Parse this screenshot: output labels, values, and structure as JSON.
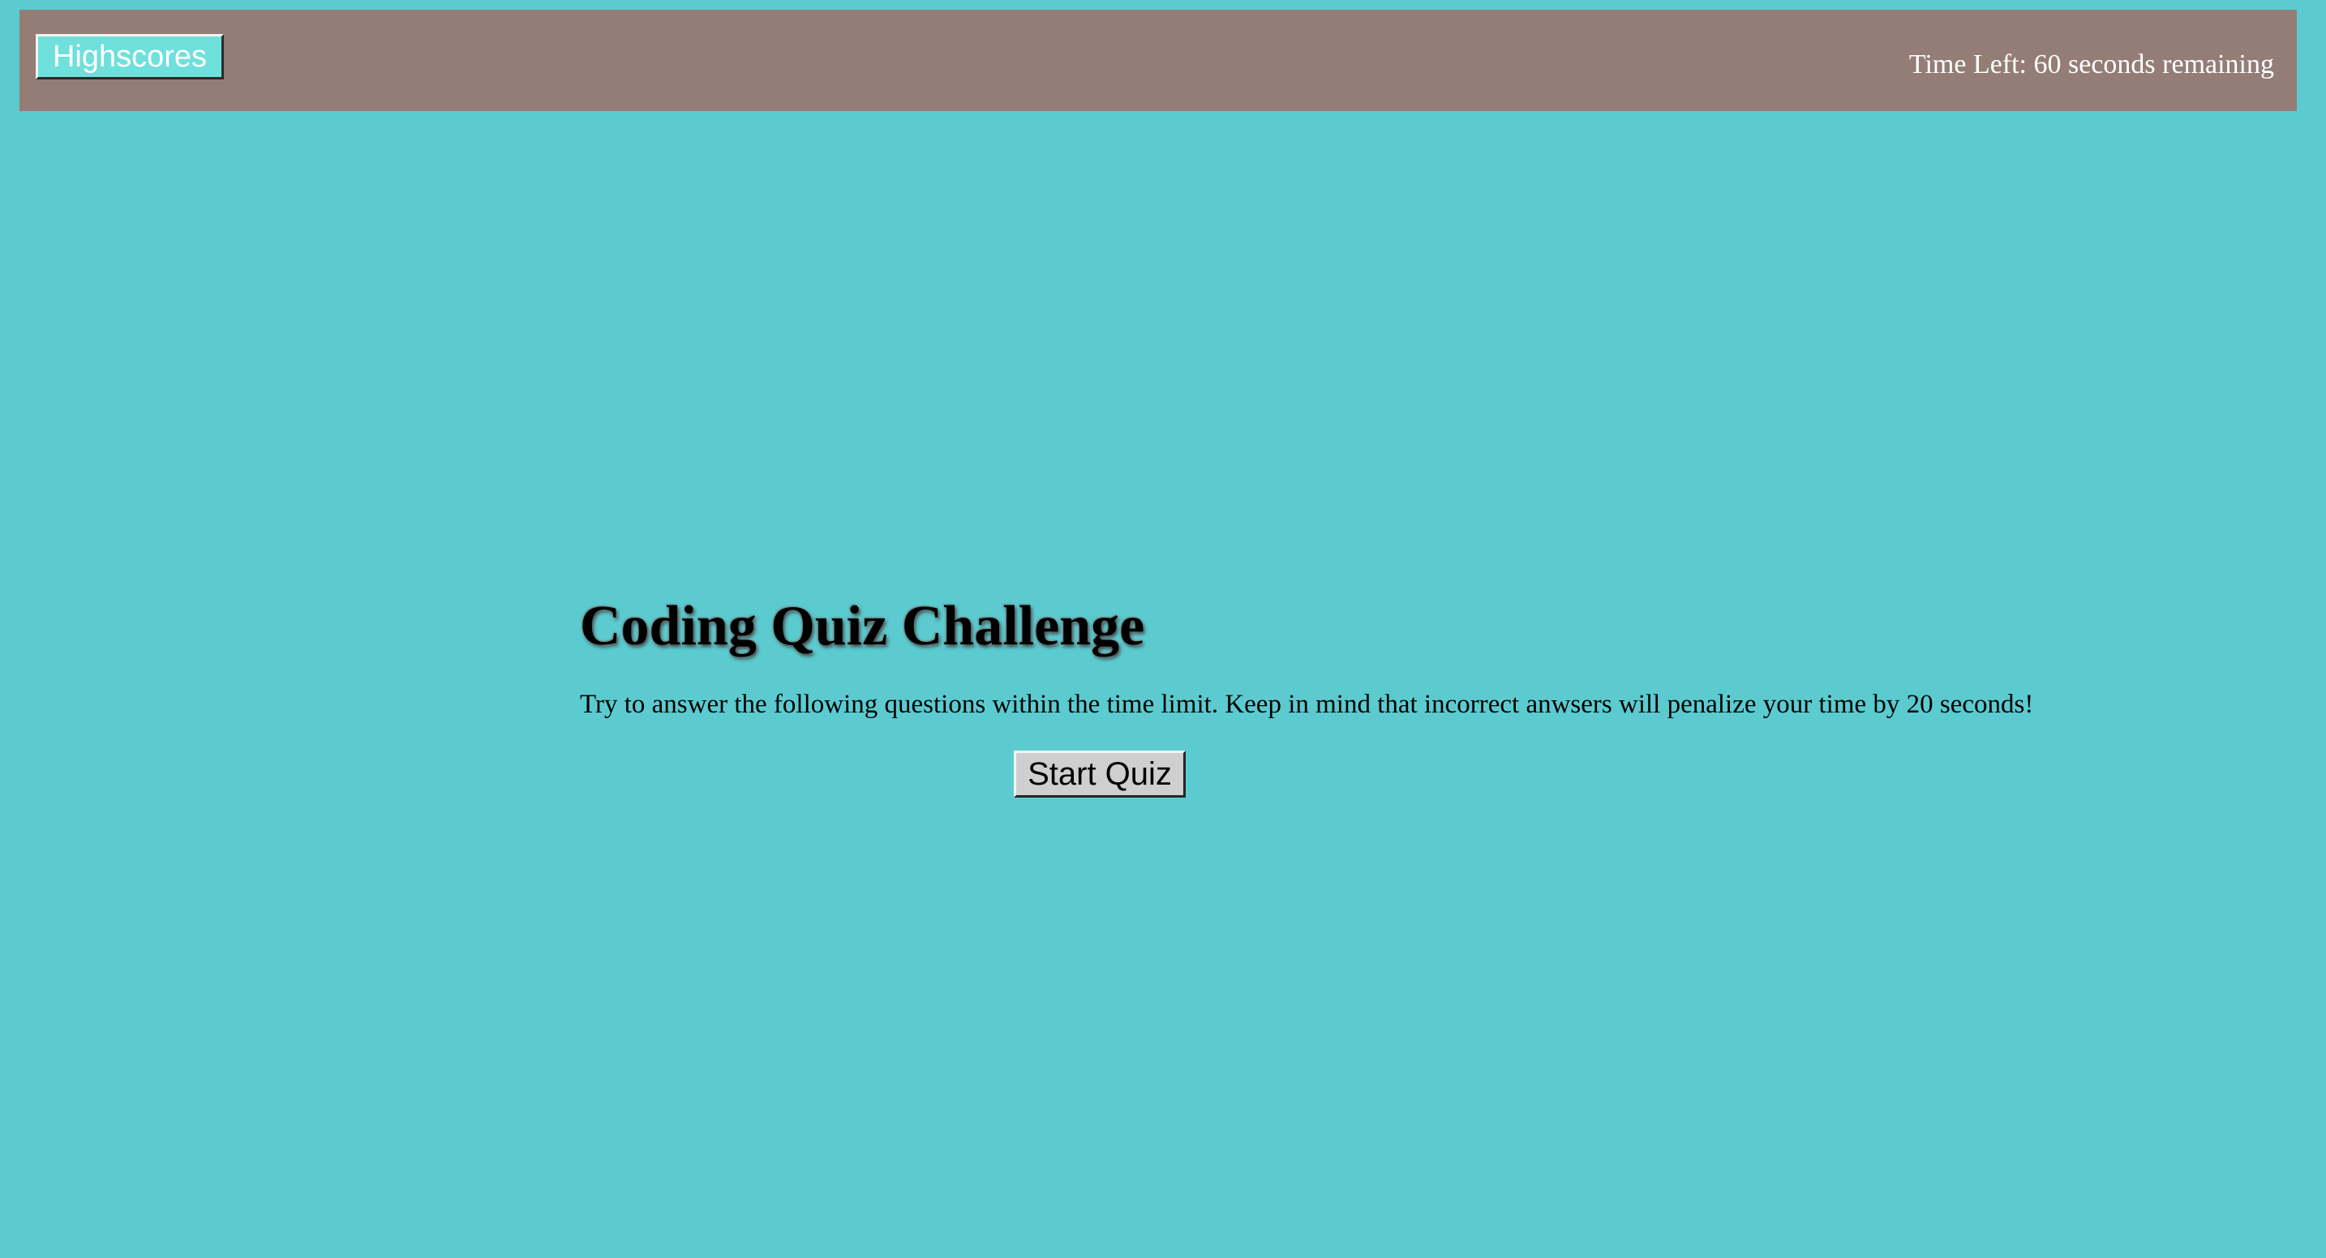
{
  "header": {
    "highscores_label": "Highscores",
    "timer_text": "Time Left: 60 seconds remaining"
  },
  "main": {
    "title": "Coding Quiz Challenge",
    "description": "Try to answer the following questions within the time limit. Keep in mind that incorrect anwsers will penalize your time by 20 seconds!",
    "start_label": "Start Quiz"
  },
  "colors": {
    "page_background": "#5bcbd0",
    "header_background": "#947d77",
    "highscores_button_background": "#6fe0dc",
    "start_button_background": "#cfcfcf"
  }
}
